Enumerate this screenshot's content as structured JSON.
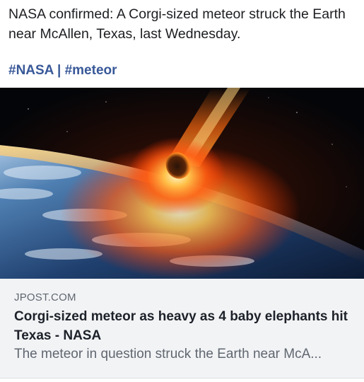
{
  "post": {
    "text": "NASA confirmed: A Corgi-sized meteor struck the Earth near McAllen, Texas, last Wednesday.",
    "hashtags": [
      "#NASA",
      "#meteor"
    ],
    "hashtag_separator": "|"
  },
  "link_card": {
    "domain": "JPOST.COM",
    "headline": "Corgi-sized meteor as heavy as 4 baby elephants hit Texas - NASA",
    "description": "The meteor in question struck the Earth near McA..."
  },
  "colors": {
    "hashtag": "#385898",
    "card_background": "#f2f3f5",
    "text_primary": "#1c1e21",
    "text_secondary": "#606770"
  }
}
